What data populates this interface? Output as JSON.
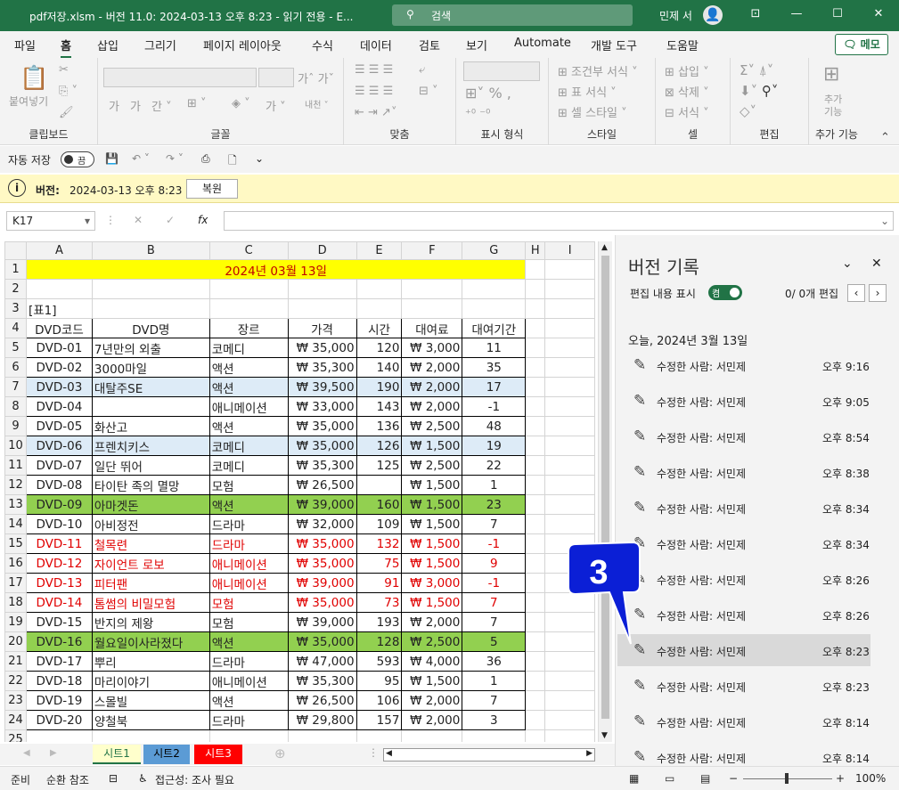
{
  "window": {
    "title": "pdf저장.xlsm  -  버전 11.0: 2024-03-13 오후 8:23  -  읽기 전용  -  E...",
    "search_placeholder": "검색",
    "user": "민제 서"
  },
  "ribbon_tabs": [
    "파일",
    "홈",
    "삽입",
    "그리기",
    "페이지 레이아웃",
    "수식",
    "데이터",
    "검토",
    "보기",
    "Automate",
    "개발 도구",
    "도움말"
  ],
  "memo_button": "메모",
  "ribbon_groups": {
    "clipboard": "클립보드",
    "paste": "붙여넣기",
    "font": "글꼴",
    "align": "맞춤",
    "number": "표시 형식",
    "styles": "스타일",
    "cells": "셀",
    "edit": "편집",
    "addins": "추가 기능",
    "addins_btn": "추가\n기능"
  },
  "ribbon_items": {
    "cond_format": "조건부 서식",
    "table_format": "표 서식",
    "cell_style": "셀 스타일",
    "insert": "삽입",
    "delete": "삭제",
    "format": "서식"
  },
  "qat": {
    "autosave": "자동 저장",
    "toggle": "끔"
  },
  "infobar": {
    "label": "버전:",
    "value": "2024-03-13 오후 8:23",
    "restore": "복원"
  },
  "namebox": "K17",
  "columns": [
    "A",
    "B",
    "C",
    "D",
    "E",
    "F",
    "G",
    "H",
    "I"
  ],
  "sheet": {
    "title": "2024년 03월 13일",
    "label": "[표1]",
    "headers": [
      "DVD코드",
      "DVD명",
      "장르",
      "가격",
      "시간",
      "대여료",
      "대여기간"
    ],
    "rows": [
      [
        "DVD-01",
        "7년만의 외출",
        "코메디",
        "₩ 35,000",
        "120",
        "₩ 3,000",
        "11"
      ],
      [
        "DVD-02",
        "3000마일",
        "액션",
        "₩ 35,300",
        "140",
        "₩ 2,000",
        "35"
      ],
      [
        "DVD-03",
        "대탈주SE",
        "액션",
        "₩ 39,500",
        "190",
        "₩ 2,000",
        "17"
      ],
      [
        "DVD-04",
        "",
        "애니메이션",
        "₩ 33,000",
        "143",
        "₩ 2,000",
        "-1"
      ],
      [
        "DVD-05",
        "화산고",
        "액션",
        "₩ 35,000",
        "136",
        "₩ 2,500",
        "48"
      ],
      [
        "DVD-06",
        "프렌치키스",
        "코메디",
        "₩ 35,000",
        "126",
        "₩ 1,500",
        "19"
      ],
      [
        "DVD-07",
        "일단 뛰어",
        "코메디",
        "₩ 35,300",
        "125",
        "₩ 2,500",
        "22"
      ],
      [
        "DVD-08",
        "타이탄 족의 멸망",
        "모험",
        "₩ 26,500",
        "",
        "₩ 1,500",
        "1"
      ],
      [
        "DVD-09",
        "아마겟돈",
        "액션",
        "₩ 39,000",
        "160",
        "₩ 1,500",
        "23"
      ],
      [
        "DVD-10",
        "아비정전",
        "드라마",
        "₩ 32,000",
        "109",
        "₩ 1,500",
        "7"
      ],
      [
        "DVD-11",
        "철목련",
        "드라마",
        "₩ 35,000",
        "132",
        "₩ 1,500",
        "-1"
      ],
      [
        "DVD-12",
        "자이언트 로보",
        "애니메이션",
        "₩ 35,000",
        "75",
        "₩ 1,500",
        "9"
      ],
      [
        "DVD-13",
        "피터팬",
        "애니메이션",
        "₩ 39,000",
        "91",
        "₩ 3,000",
        "-1"
      ],
      [
        "DVD-14",
        "톰썸의 비밀모험",
        "모험",
        "₩ 35,000",
        "73",
        "₩ 1,500",
        "7"
      ],
      [
        "DVD-15",
        "반지의 제왕",
        "모험",
        "₩ 39,000",
        "193",
        "₩ 2,000",
        "7"
      ],
      [
        "DVD-16",
        "월요일이사라졌다",
        "액션",
        "₩ 35,000",
        "128",
        "₩ 2,500",
        "5"
      ],
      [
        "DVD-17",
        "뿌리",
        "드라마",
        "₩ 47,000",
        "593",
        "₩ 4,000",
        "36"
      ],
      [
        "DVD-18",
        "마리이야기",
        "애니메이션",
        "₩ 35,300",
        "95",
        "₩ 1,500",
        "1"
      ],
      [
        "DVD-19",
        "스몰빌",
        "액션",
        "₩ 26,500",
        "106",
        "₩ 2,000",
        "7"
      ],
      [
        "DVD-20",
        "양철북",
        "드라마",
        "₩ 29,800",
        "157",
        "₩ 2,000",
        "3"
      ]
    ],
    "row_styles": [
      "",
      "",
      "blue",
      "",
      "",
      "blue",
      "",
      "",
      "green",
      "",
      "red",
      "red",
      "red",
      "red",
      "",
      "green",
      "",
      "",
      "",
      ""
    ],
    "row_numbers": [
      "1",
      "2",
      "3",
      "4",
      "5",
      "6",
      "7",
      "8",
      "9",
      "10",
      "11",
      "12",
      "13",
      "14",
      "15",
      "16",
      "17",
      "18",
      "19",
      "20",
      "21",
      "22",
      "23",
      "24",
      "25"
    ]
  },
  "colors": {
    "blue": "#ddebf7",
    "green": "#92d050",
    "red": "#e00000",
    "yellow": "#ffff00",
    "excel_green": "#217346"
  },
  "sheet_tabs": [
    {
      "label": "시트1",
      "bg": "#ffffcc",
      "color": "#217346"
    },
    {
      "label": "시트2",
      "bg": "#5b9bd5",
      "color": "#000"
    },
    {
      "label": "시트3",
      "bg": "#ff0000",
      "color": "#fff"
    }
  ],
  "status": {
    "ready": "준비",
    "circular": "순환 참조",
    "accessibility": "접근성: 조사 필요",
    "zoom": "100%"
  },
  "panel": {
    "title": "버전 기록",
    "show_edits": "편집 내용 표시",
    "toggle": "켬",
    "edits_count": "0/ 0개 편집",
    "date_heading": "오늘, 2024년 3월 13일",
    "versions": [
      {
        "who": "수정한 사람: 서민제",
        "time": "오후 9:16"
      },
      {
        "who": "수정한 사람: 서민제",
        "time": "오후 9:05"
      },
      {
        "who": "수정한 사람: 서민제",
        "time": "오후 8:54"
      },
      {
        "who": "수정한 사람: 서민제",
        "time": "오후 8:38"
      },
      {
        "who": "수정한 사람: 서민제",
        "time": "오후 8:34"
      },
      {
        "who": "수정한 사람: 서민제",
        "time": "오후 8:34"
      },
      {
        "who": "수정한 사람: 서민제",
        "time": "오후 8:26"
      },
      {
        "who": "수정한 사람: 서민제",
        "time": "오후 8:26"
      },
      {
        "who": "수정한 사람: 서민제",
        "time": "오후 8:23"
      },
      {
        "who": "수정한 사람: 서민제",
        "time": "오후 8:23"
      },
      {
        "who": "수정한 사람: 서민제",
        "time": "오후 8:14"
      },
      {
        "who": "수정한 사람: 서민제",
        "time": "오후 8:14"
      }
    ],
    "selected_index": 8
  },
  "callout": {
    "number": "3"
  }
}
